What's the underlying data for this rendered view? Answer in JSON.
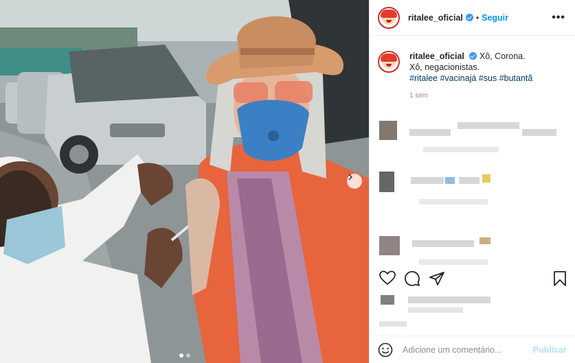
{
  "post": {
    "username": "ritalee_oficial",
    "follow_label": "Seguir",
    "more_label": "•••",
    "caption_lines": [
      "Xô, Corona.",
      "Xô, negacionistas."
    ],
    "hashtags": [
      "#ritalee",
      "#vacinajá",
      "#sus",
      "#butantã"
    ],
    "time_ago": "1 sem"
  },
  "comment_box": {
    "placeholder": "Adicione um comentário...",
    "publish_label": "Publicar"
  },
  "carousel": {
    "slides": 2,
    "active_index": 0
  },
  "colors": {
    "verified": "#3897f0",
    "follow": "#0095f6",
    "hashtag": "#00376b",
    "publish_disabled": "#b2dffc",
    "avatar_ring": "#d12a2a"
  },
  "icons": [
    "heart-icon",
    "comment-icon",
    "share-icon",
    "bookmark-icon",
    "emoji-icon",
    "chevron-right-icon",
    "more-options-icon",
    "verified-icon"
  ]
}
